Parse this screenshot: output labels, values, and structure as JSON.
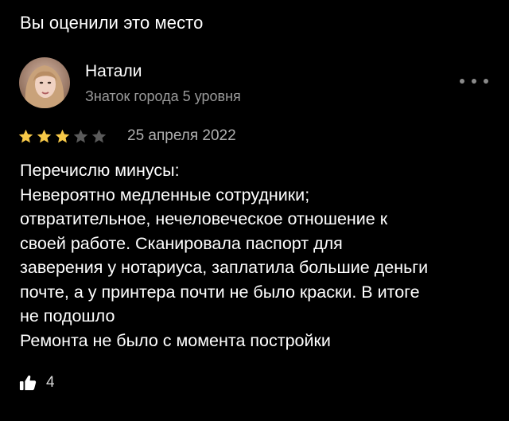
{
  "section": {
    "title": "Вы оценили это место"
  },
  "review": {
    "author": {
      "name": "Натали",
      "level": "Знаток города 5 уровня"
    },
    "rating": 3,
    "max_rating": 5,
    "date": "25 апреля 2022",
    "text_lines": [
      "Перечислю минусы:",
      "Невероятно медленные сотрудники;",
      "отвратительное, нечеловеческое отношение к",
      "своей работе. Сканировала паспорт для",
      "заверения у нотариуса, заплатила большие деньги",
      "почте, а у принтера почти не было краски. В итоге",
      "не подошло",
      "Ремонта не было с момента постройки"
    ],
    "likes": "4"
  },
  "icons": {
    "more": "more-horizontal-icon",
    "like": "thumbs-up-icon",
    "star": "star-icon"
  },
  "colors": {
    "background": "#000000",
    "star_filled": "#f7c948",
    "star_empty": "#5a5a5a",
    "secondary_text": "#9a9a9a"
  }
}
